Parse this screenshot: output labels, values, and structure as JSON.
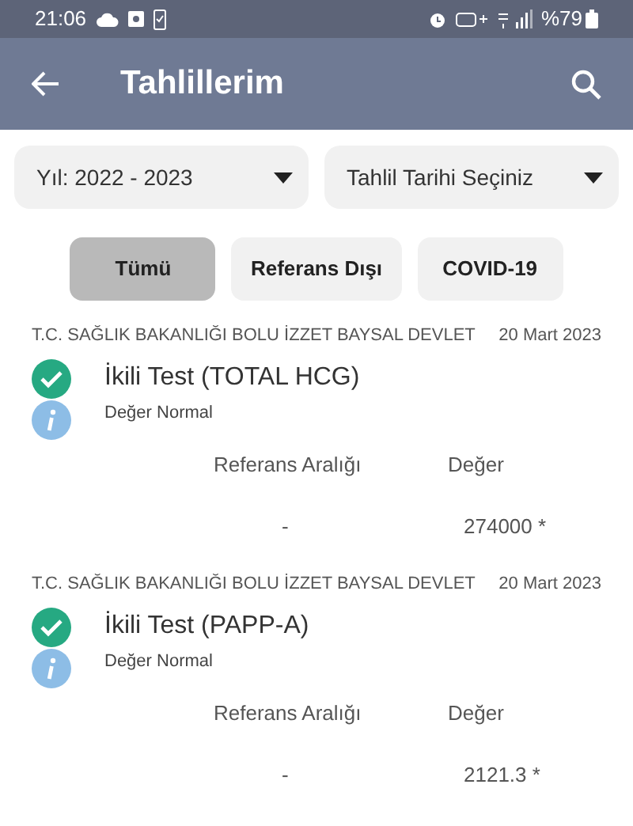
{
  "status_bar": {
    "time": "21:06",
    "battery": "%79"
  },
  "app_bar": {
    "title": "Tahlillerim"
  },
  "dropdowns": [
    {
      "label": "Yıl: 2022 - 2023"
    },
    {
      "label": "Tahlil Tarihi Seçiniz"
    }
  ],
  "filters": [
    {
      "label": "Tümü",
      "selected": true
    },
    {
      "label": "Referans Dışı",
      "selected": false
    },
    {
      "label": "COVID-19",
      "selected": false
    }
  ],
  "results": [
    {
      "hospital": "T.C. SAĞLIK BAKANLIĞI BOLU İZZET BAYSAL DEVLET",
      "date": "20 Mart 2023",
      "test": "İkili Test (TOTAL HCG)",
      "status": "Değer Normal",
      "range_header": "Referans Aralığı",
      "value_header": "Değer",
      "range": "-",
      "value": "274000 *"
    },
    {
      "hospital": "T.C. SAĞLIK BAKANLIĞI BOLU İZZET BAYSAL DEVLET",
      "date": "20 Mart 2023",
      "test": "İkili Test (PAPP-A)",
      "status": "Değer Normal",
      "range_header": "Referans Aralığı",
      "value_header": "Değer",
      "range": "-",
      "value": "2121.3 *"
    }
  ]
}
